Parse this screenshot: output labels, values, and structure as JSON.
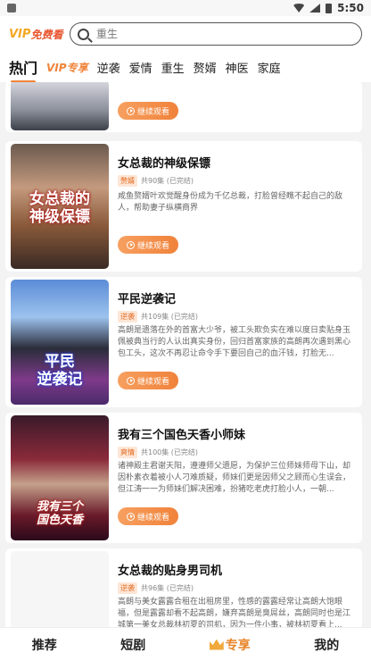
{
  "status_bar": {
    "time": "5:50"
  },
  "header": {
    "logo_vip": "VIP",
    "logo_text": "免费看",
    "search_placeholder": "重生"
  },
  "tabs": [
    "热门",
    "VIP专享",
    "逆袭",
    "爱情",
    "重生",
    "赘婿",
    "神医",
    "家庭"
  ],
  "cards": [
    {
      "title": "",
      "tag": "",
      "episodes": "",
      "desc": "",
      "button": "继续观看",
      "cover_text": ""
    },
    {
      "title": "女总裁的神级保镖",
      "tag": "赘婿",
      "episodes": "共90集 (已完结)",
      "desc": "咸鱼赘婿叶欢觉醒身份成为千亿总裁，打脸曾经瞧不起自己的敌人，帮助妻子纵横商界",
      "button": "继续观看",
      "cover_text": "女总裁的\n神级保镖"
    },
    {
      "title": "平民逆袭记",
      "tag": "逆袭",
      "episodes": "共109集 (已完结)",
      "desc": "高朗是遗落在外的首富大少爷，被工头欺负实在难以度日卖贴身玉佩被典当行的人认出真实身份，回归首富家族的高朗再次遇到黑心包工头，这次不再忍让命令手下要回自己的血汗钱，打脸无...",
      "button": "继续观看",
      "cover_text": "平民\n逆袭记"
    },
    {
      "title": "我有三个国色天香小师妹",
      "tag": "爽情",
      "episodes": "共100集 (已完结)",
      "desc": "诸神殿主君谢天阳，遵遵师父遗愿，为保护三位师妹师母下山，却因朴素衣着被小人刁难质疑，师妹们更是因师父之顾而心生误会，但江涛一一为师妹们解决困难，扮猪吃老虎打脸小人，一朝...",
      "button": "继续观看",
      "cover_text": "我有三个\n国色天香"
    },
    {
      "title": "女总裁的贴身男司机",
      "tag": "逆袭",
      "episodes": "共96集 (已完结)",
      "desc": "高朗与美女露露合租在出租房里，性感的露露经常让高朗大饱眼福，但是露露却看不起高朗，嫌弃高朗是臭屌丝，高朗同时也是江城第一美女总裁林初夏的司机，因为一件小事，被林初夏看上...",
      "button": "继续观看",
      "cover_text": ""
    }
  ],
  "bottom_nav": [
    "推荐",
    "短剧",
    "专享",
    "我的"
  ],
  "colors": {
    "accent": "#f0843a",
    "vip_gold": "#f5b323"
  }
}
